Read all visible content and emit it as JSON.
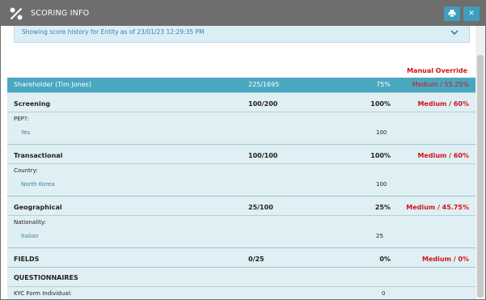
{
  "window": {
    "title": "SCORING INFO"
  },
  "banner": {
    "text": "Showing score history for Entity as of 23/01/23 12:29:35 PM"
  },
  "override_label": "Manual Override",
  "header_row": {
    "name": "Shareholder (Tim Jones)",
    "ratio": "225/1695",
    "pct": "75%",
    "risk": "Medium / 55.25%"
  },
  "sections": [
    {
      "name": "Screening",
      "ratio": "100/200",
      "pct": "100%",
      "risk": "Medium / 60%",
      "sub_label": "PEP?:",
      "sub_value": "Yes",
      "sub_num": "100"
    },
    {
      "name": "Transactional",
      "ratio": "100/100",
      "pct": "100%",
      "risk": "Medium / 60%",
      "sub_label": "Country:",
      "sub_value": "North Korea",
      "sub_num": "100"
    },
    {
      "name": "Geographical",
      "ratio": "25/100",
      "pct": "25%",
      "risk": "Medium / 45.75%",
      "sub_label": "Nationality:",
      "sub_value": "Italian",
      "sub_num": "25"
    },
    {
      "name": "FIELDS",
      "ratio": "0/25",
      "pct": "0%",
      "risk": "Medium / 0%"
    },
    {
      "name": "QUESTIONNAIRES",
      "ratio": "",
      "pct": "",
      "risk": "",
      "sub_label": "KYC Form Individual:",
      "sub_num": "0"
    }
  ],
  "colors": {
    "accent": "#4aa7c0",
    "risk_red": "#d0131e",
    "titlebar": "#6e6e6e"
  }
}
